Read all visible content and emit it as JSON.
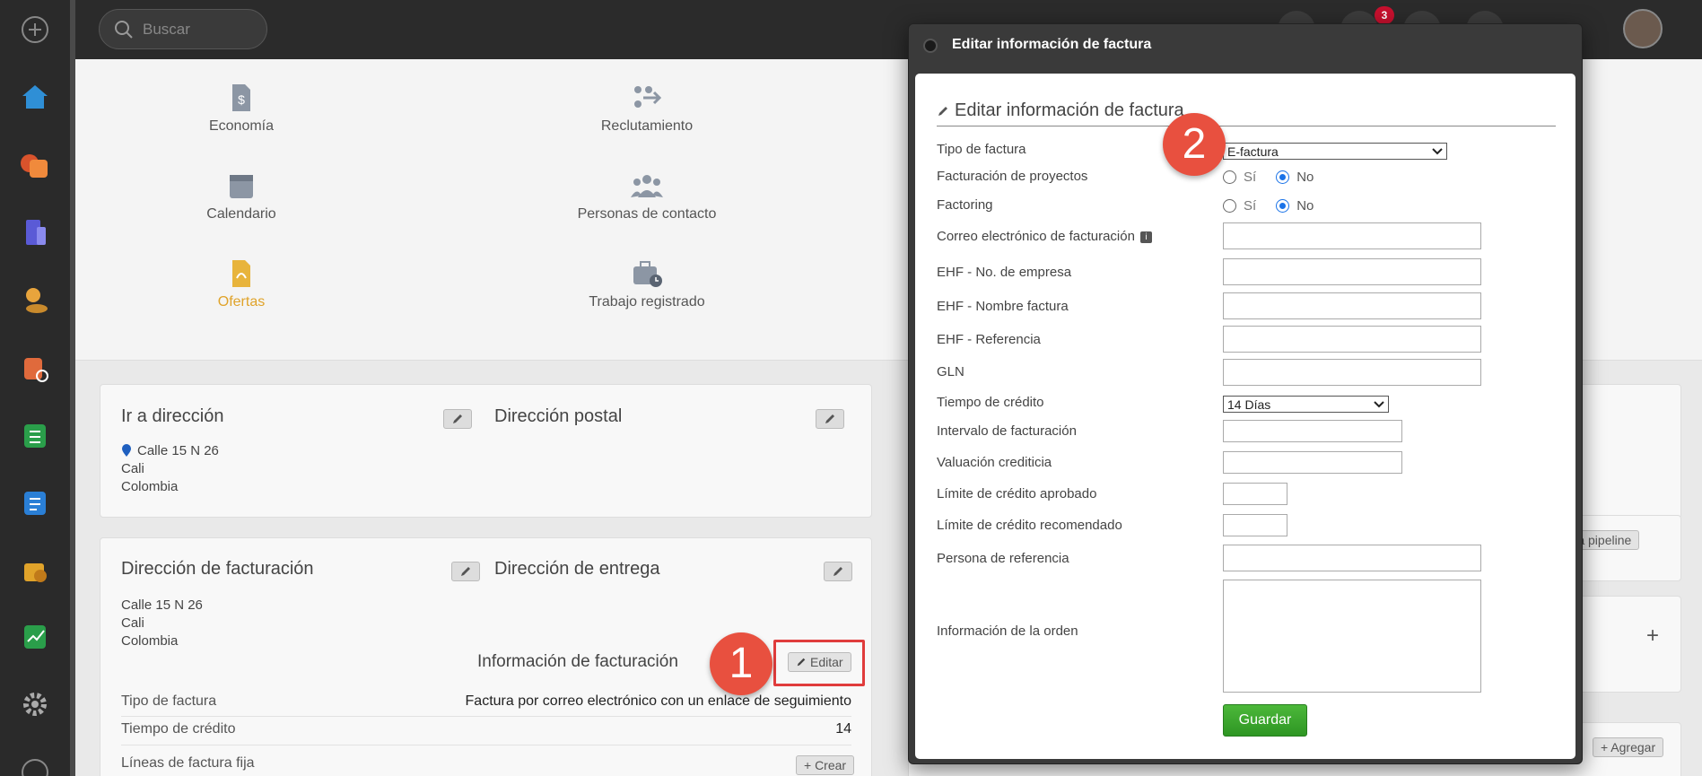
{
  "search": {
    "placeholder": "Buscar"
  },
  "topbar": {
    "notification_count": "3"
  },
  "shortcuts": [
    {
      "label": "Economía",
      "icon": "dollar-document-icon"
    },
    {
      "label": "Reclutamiento",
      "icon": "recruitment-icon"
    },
    {
      "label": "Calendario",
      "icon": "calendar-icon"
    },
    {
      "label": "Personas de contacto",
      "icon": "contacts-icon"
    },
    {
      "label": "Ofertas",
      "icon": "offer-document-icon"
    },
    {
      "label": "Trabajo registrado",
      "icon": "timesheet-icon"
    }
  ],
  "visit_address": {
    "title": "Ir a dirección",
    "street": "Calle 15 N 26",
    "city": "Cali",
    "country": "Colombia"
  },
  "postal_address": {
    "title": "Dirección postal"
  },
  "billing_address": {
    "title": "Dirección de facturación",
    "street": "Calle 15 N 26",
    "city": "Cali",
    "country": "Colombia"
  },
  "delivery_address": {
    "title": "Dirección de entrega"
  },
  "invoice_info": {
    "title": "Información de facturación",
    "edit_label": "Editar",
    "rows": [
      {
        "label": "Tipo de factura",
        "value": "Factura por correo electrónico con un enlace de seguimiento"
      },
      {
        "label": "Tiempo de crédito",
        "value": "14"
      },
      {
        "label": "Líneas de factura fija",
        "value": ""
      }
    ],
    "create_label": "+ Crear"
  },
  "right_panel": {
    "pipeline_label": "ar a pipeline",
    "add_label": "+ Agregar",
    "plus": "+"
  },
  "callouts": {
    "one": "1",
    "two": "2"
  },
  "modal": {
    "window_title": "Editar información de factura",
    "heading": "Editar información de factura",
    "fields": {
      "invoice_type": {
        "label": "Tipo de factura",
        "value": "E-factura"
      },
      "project_billing": {
        "label": "Facturación de proyectos",
        "yes": "Sí",
        "no": "No",
        "selected": "No"
      },
      "factoring": {
        "label": "Factoring",
        "yes": "Sí",
        "no": "No",
        "selected": "No"
      },
      "billing_email": {
        "label": "Correo electrónico de facturación",
        "info": "i",
        "value": ""
      },
      "ehf_company_no": {
        "label": "EHF - No. de empresa",
        "value": ""
      },
      "ehf_invoice_name": {
        "label": "EHF - Nombre factura",
        "value": ""
      },
      "ehf_reference": {
        "label": "EHF - Referencia",
        "value": ""
      },
      "gln": {
        "label": "GLN",
        "value": ""
      },
      "credit_time": {
        "label": "Tiempo de crédito",
        "value": "14 Días"
      },
      "billing_interval": {
        "label": "Intervalo de facturación",
        "value": ""
      },
      "credit_rating": {
        "label": "Valuación crediticia",
        "value": ""
      },
      "approved_credit_limit": {
        "label": "Límite de crédito aprobado",
        "value": ""
      },
      "recommended_credit_limit": {
        "label": "Límite de crédito recomendado",
        "value": ""
      },
      "reference_person": {
        "label": "Persona de referencia",
        "value": ""
      },
      "order_info": {
        "label": "Información de la orden",
        "value": ""
      }
    },
    "save_label": "Guardar"
  },
  "colors": {
    "accent_orange": "#e0a32a",
    "callout_red": "#e8503f",
    "save_green": "#3aa52d",
    "radio_blue": "#1a73e8"
  }
}
